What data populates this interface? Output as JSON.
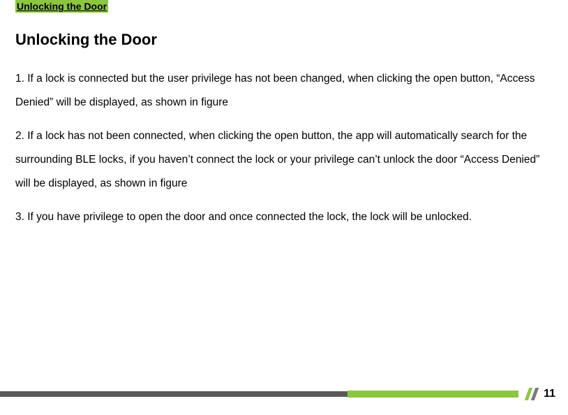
{
  "highlighted_title": "Unlocking the Door",
  "section_heading": "Unlocking the Door",
  "paragraphs": [
    "1. If a lock is connected but the user privilege has not been changed, when clicking the open button, “Access Denied” will be displayed, as shown in figure",
    "2. If a lock has not been connected, when clicking the open button, the app will automatically search for the surrounding BLE locks, if you haven’t connect the lock or your privilege can’t unlock the door “Access Denied” will be displayed, as shown in figure",
    "3. If you have privilege to open the door and once connected the lock, the lock will be unlocked."
  ],
  "page_number": "11"
}
